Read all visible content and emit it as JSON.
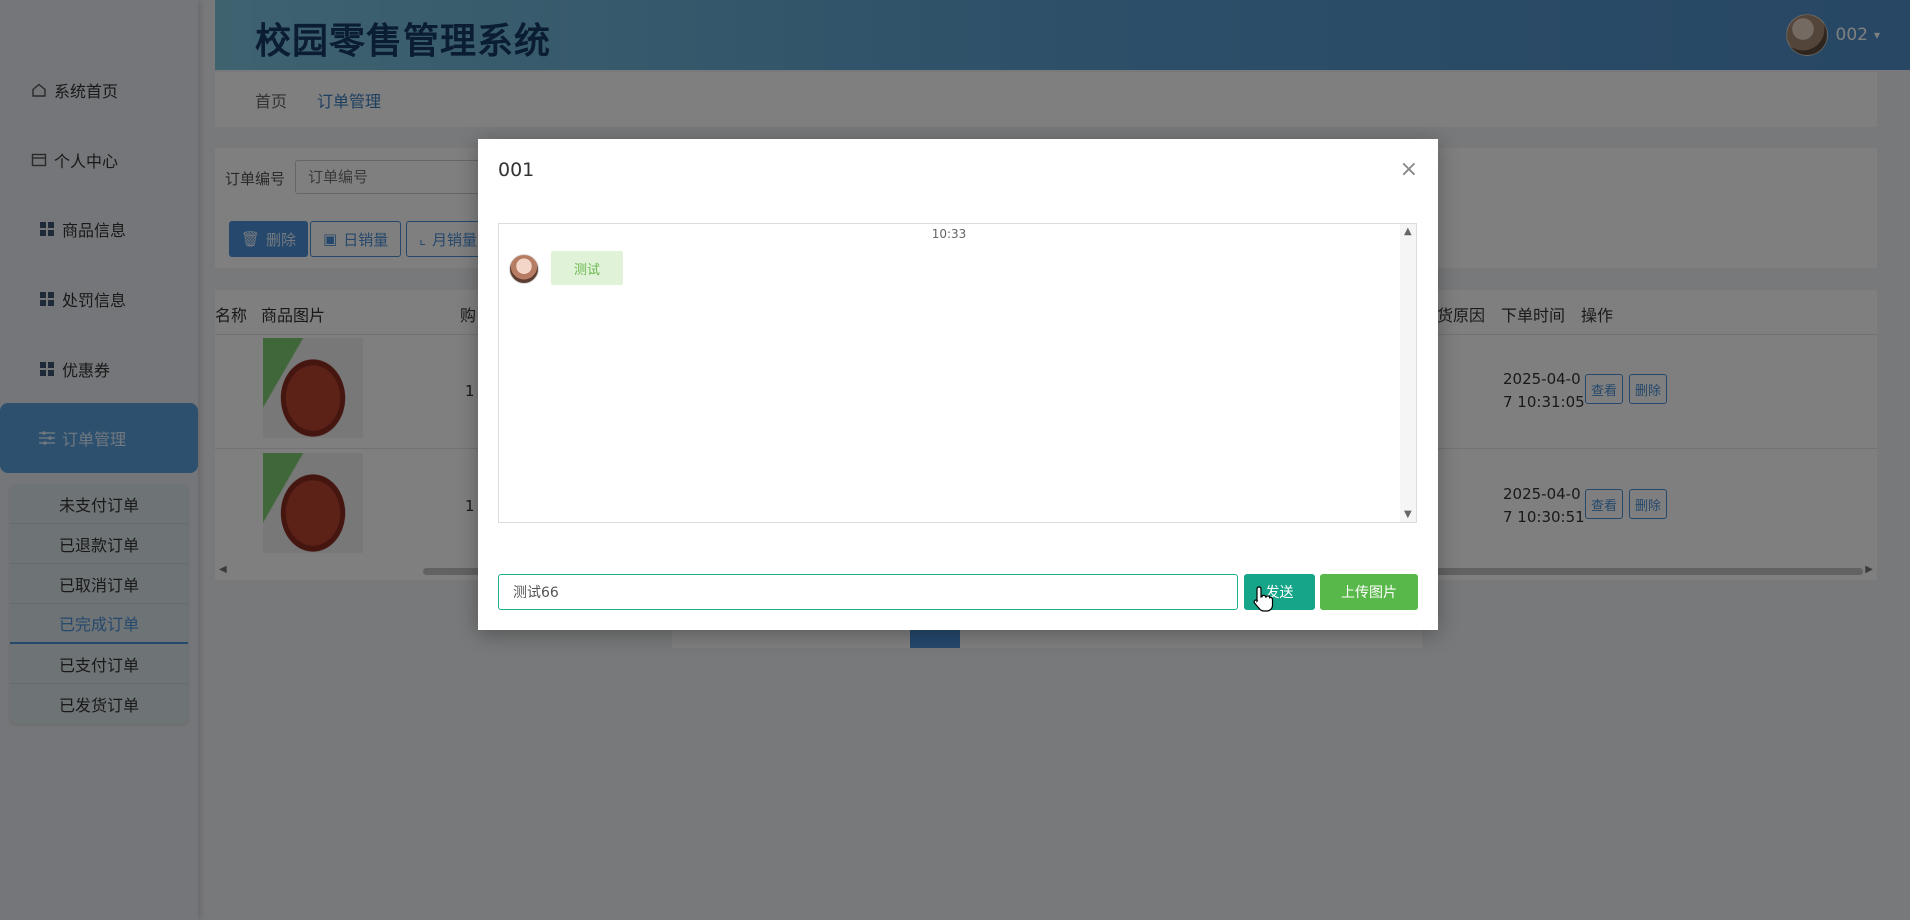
{
  "app": {
    "title": "校园零售管理系统"
  },
  "user": {
    "name": "002",
    "caret": "▾"
  },
  "sidebar": {
    "items": [
      {
        "label": "系统首页",
        "icon": "home-icon"
      },
      {
        "label": "个人中心",
        "icon": "id-card-icon"
      },
      {
        "label": "商品信息",
        "icon": "grid-icon"
      },
      {
        "label": "处罚信息",
        "icon": "grid-icon"
      },
      {
        "label": "优惠券",
        "icon": "grid-icon"
      },
      {
        "label": "订单管理",
        "icon": "sliders-icon"
      }
    ],
    "sub_items": [
      {
        "label": "未支付订单"
      },
      {
        "label": "已退款订单"
      },
      {
        "label": "已取消订单"
      },
      {
        "label": "已完成订单"
      },
      {
        "label": "已支付订单"
      },
      {
        "label": "已发货订单"
      }
    ]
  },
  "breadcrumb": [
    {
      "label": "首页"
    },
    {
      "label": "订单管理"
    }
  ],
  "search": {
    "label": "订单编号",
    "placeholder": "订单编号"
  },
  "toolbar": {
    "delete_label": "删除",
    "daily_label": "日销量",
    "monthly_label": "月销量"
  },
  "table": {
    "headers": {
      "name": "名称",
      "image": "商品图片",
      "qty": "购",
      "reason": "货原因",
      "time": "下单时间",
      "ops": "操作"
    },
    "rows": [
      {
        "qty": "1",
        "time_line1": "2025-04-0",
        "time_line2": "7 10:31:05",
        "view": "查看",
        "delete": "删除"
      },
      {
        "qty": "1",
        "time_line1": "2025-04-0",
        "time_line2": "7 10:30:51",
        "view": "查看",
        "delete": "删除"
      }
    ]
  },
  "modal": {
    "title": "001",
    "close": "×",
    "chat": {
      "time": "10:33",
      "message": "测试"
    },
    "input_value": "测试66",
    "send_label": "发送",
    "upload_label": "上传图片"
  }
}
